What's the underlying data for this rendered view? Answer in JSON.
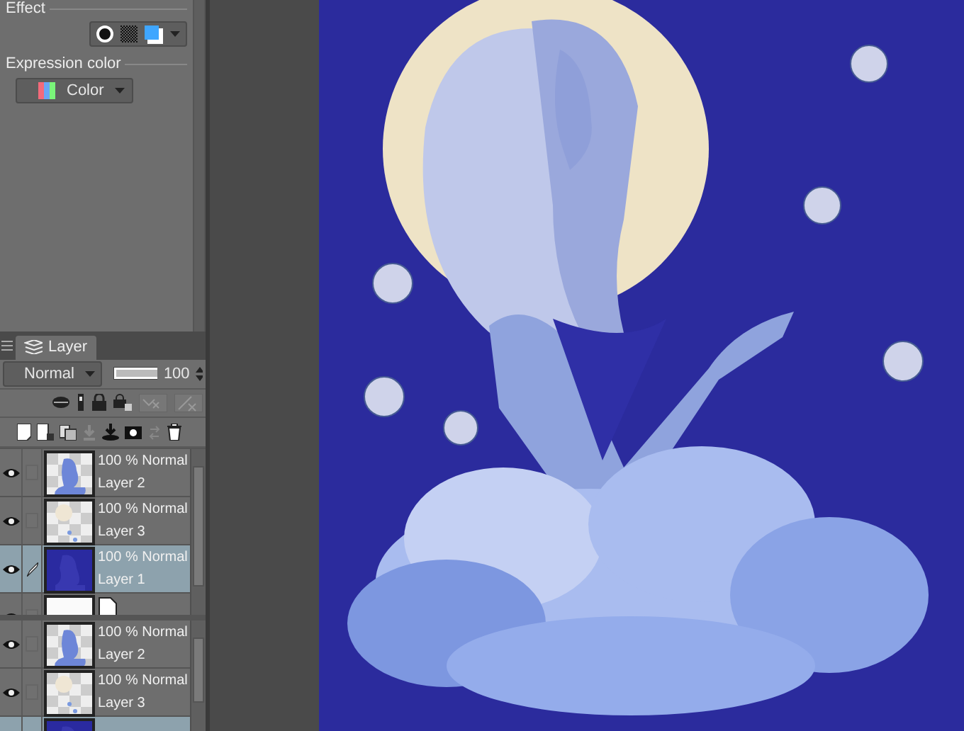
{
  "effect": {
    "label": "Effect"
  },
  "expression_color": {
    "label": "Expression color",
    "value": "Color"
  },
  "layer_panel": {
    "tab": "Layer",
    "blend_mode": "Normal",
    "opacity_slider": {
      "level": 1
    },
    "opacity": "100",
    "lists": [
      {
        "layers": [
          {
            "kind": "raster",
            "thumb": {
              "kind": "figure"
            },
            "visible": true,
            "selected": false,
            "mode": "100 % Normal",
            "name": "Layer 2"
          },
          {
            "kind": "raster",
            "thumb": {
              "kind": "sketch"
            },
            "visible": true,
            "selected": false,
            "mode": "100 % Normal",
            "name": "Layer 3"
          },
          {
            "kind": "raster",
            "thumb": {
              "kind": "fill"
            },
            "visible": true,
            "selected": true,
            "mode": "100 % Normal",
            "name": "Layer 1"
          },
          {
            "kind": "paper",
            "thumb": {
              "kind": "white"
            },
            "visible": true,
            "selected": false
          }
        ]
      },
      {
        "layers": [
          {
            "kind": "raster",
            "thumb": {
              "kind": "figure"
            },
            "visible": true,
            "selected": false,
            "mode": "100 % Normal",
            "name": "Layer 2"
          },
          {
            "kind": "raster",
            "thumb": {
              "kind": "sketch"
            },
            "visible": true,
            "selected": false,
            "mode": "100 % Normal",
            "name": "Layer 3"
          },
          {
            "kind": "raster",
            "thumb": {
              "kind": "fill"
            },
            "selected": true
          }
        ]
      }
    ]
  }
}
